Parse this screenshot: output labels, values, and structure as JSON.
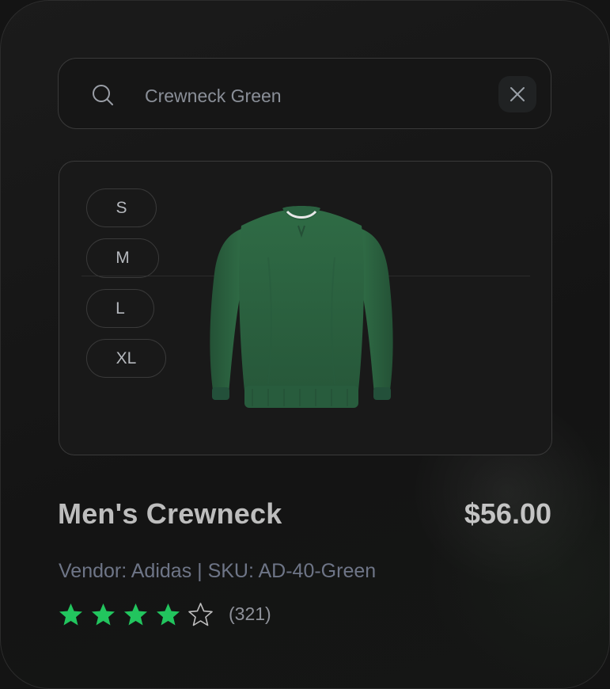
{
  "search": {
    "value": "Crewneck Green",
    "placeholder": "Crewneck Green"
  },
  "sizes": [
    "S",
    "M",
    "L",
    "XL"
  ],
  "product": {
    "image": "green-crewneck-sweater",
    "name": "Men's Crewneck",
    "price": "$56.00",
    "meta": "Vendor: Adidas | SKU: AD-40-Green"
  },
  "rating": {
    "stars": 4,
    "max": 5,
    "count_label": "(321)"
  },
  "colors": {
    "star_filled": "#22c55e",
    "star_empty_stroke": "#bfbfbf",
    "sweater": "#2f6b45"
  },
  "icons": {
    "search": "search-icon",
    "clear": "close-icon",
    "star": "star-icon"
  }
}
